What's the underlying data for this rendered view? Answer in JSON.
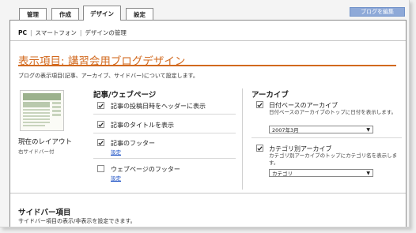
{
  "tabs": [
    {
      "label": "管理"
    },
    {
      "label": "作成"
    },
    {
      "label": "デザイン"
    },
    {
      "label": "設定"
    }
  ],
  "blog_button": "ブログを編集",
  "subnav": {
    "pc": "PC",
    "smartphone": "スマートフォン",
    "manage": "デザインの管理"
  },
  "page_title": "表示項目: 講習会用ブログデザイン",
  "description": "ブログの表示項目(記事、アーカイブ、サイドバー)について設定します。",
  "layout": {
    "caption": "現在のレイアウト",
    "sub": "右サイドバー付"
  },
  "articles": {
    "title": "記事/ウェブページ",
    "items": [
      {
        "label": "記事の投稿日時をヘッダーに表示",
        "checked": true
      },
      {
        "label": "記事のタイトルを表示",
        "checked": true
      },
      {
        "label": "記事のフッター",
        "checked": true,
        "link": "設定"
      },
      {
        "label": "ウェブページのフッター",
        "checked": false,
        "link": "設定"
      }
    ]
  },
  "archives": {
    "title": "アーカイブ",
    "items": [
      {
        "label": "日付ベースのアーカイブ",
        "checked": true,
        "desc": "日付ベースのアーカイブのトップに日付を表示します。",
        "select": "2007年3月"
      },
      {
        "label": "カテゴリ別アーカイブ",
        "checked": true,
        "desc": "カテゴリ別アーカイブのトップにカテゴリ名を表示します。",
        "select": "カテゴリ"
      }
    ]
  },
  "sidebar": {
    "title": "サイドバー項目",
    "desc": "サイドバー項目の表示/非表示を設定できます。"
  },
  "colors": {
    "accent": "#d2691e",
    "link": "#1a4fc4",
    "blog_button": "#8ea9d8"
  }
}
